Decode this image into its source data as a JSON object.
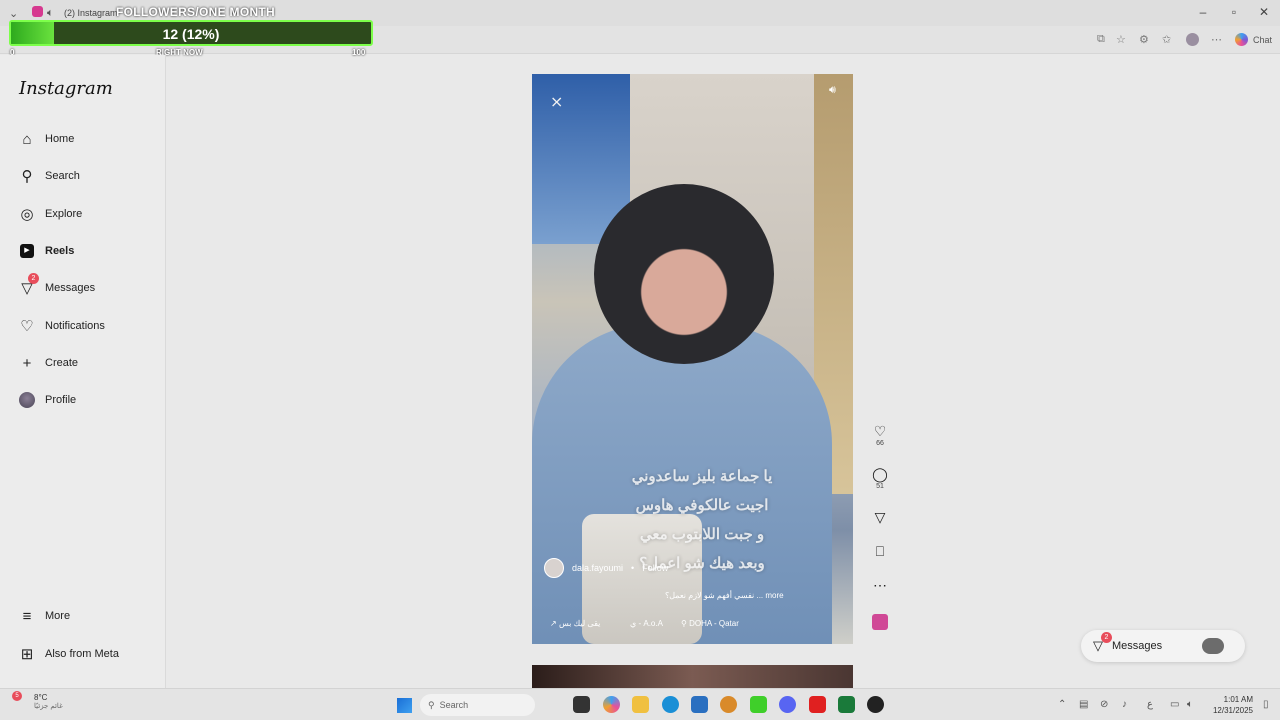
{
  "browser": {
    "tab_title": "(2) Instagram",
    "chat_label": "Chat"
  },
  "followers_widget": {
    "title": "FOLLOWERS/ONE MONTH",
    "current_text": "12 (12%)",
    "progress_percent": 12,
    "min_label": "0",
    "center_label": "RIGHT NOW",
    "max_label": "100",
    "fill_color": "#6ae23e",
    "border_color": "#7dff4a"
  },
  "sidebar": {
    "logo": "Instagram",
    "items": [
      {
        "label": "Home",
        "icon": "home-icon"
      },
      {
        "label": "Search",
        "icon": "search-icon"
      },
      {
        "label": "Explore",
        "icon": "compass-icon"
      },
      {
        "label": "Reels",
        "icon": "reels-icon"
      },
      {
        "label": "Messages",
        "icon": "messenger-icon",
        "badge": "2"
      },
      {
        "label": "Notifications",
        "icon": "heart-icon"
      },
      {
        "label": "Create",
        "icon": "plus-icon"
      },
      {
        "label": "Profile",
        "icon": "avatar"
      }
    ],
    "more_label": "More",
    "meta_label": "Also from Meta"
  },
  "reel": {
    "caption_lines": [
      "يا جماعة بليز ساعدوني",
      "اجيت عالكوفي هاوس",
      "و جبت اللابتوب معي",
      "وبعد هيك شو اعمل؟"
    ],
    "username": "dala.fayoumi",
    "follow_label": "Follow",
    "description": "نفسي أفهم شو لازم نعمل؟ ... more",
    "audio_text": "يقى ليك بس",
    "audio_tag": "ي - A.o.A",
    "location": "DOHA - Qatar"
  },
  "actions": {
    "likes": "66",
    "comments": "51"
  },
  "messages_bubble": {
    "label": "Messages",
    "badge": "2"
  },
  "taskbar": {
    "temperature": "8°C",
    "weather_desc": "غائم جزئيًا",
    "weather_badge": "5",
    "search_placeholder": "Search",
    "time": "1:01 AM",
    "date": "12/31/2025",
    "lang": "ع"
  }
}
